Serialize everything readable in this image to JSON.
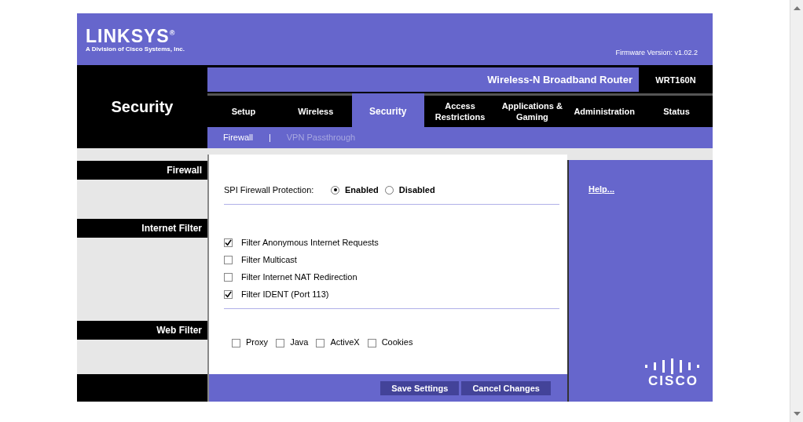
{
  "header": {
    "logo": "LINKSYS$^{®}$",
    "tagline": "A Division of Cisco Systems, Inc.",
    "firmware": "Firmware Version: v1.02.2"
  },
  "page_title": "Security",
  "product": {
    "name": "Wireless-N Broadband Router",
    "model": "WRT160N"
  },
  "tabs": [
    {
      "label": "Setup",
      "selected": false
    },
    {
      "label": "Wireless",
      "selected": false
    },
    {
      "label": "Security",
      "selected": true
    },
    {
      "label": "Access Restrictions",
      "selected": false
    },
    {
      "label": "Applications & Gaming",
      "selected": false
    },
    {
      "label": "Administration",
      "selected": false
    },
    {
      "label": "Status",
      "selected": false
    }
  ],
  "subtabs": [
    {
      "label": "Firewall",
      "selected": true
    },
    {
      "label": "VPN Passthrough",
      "selected": false
    }
  ],
  "subtab_separator": "|",
  "sections": [
    "Firewall",
    "Internet Filter",
    "Web Filter"
  ],
  "spi": {
    "label": "SPI Firewall Protection:",
    "options": [
      {
        "label": "Enabled",
        "selected": true
      },
      {
        "label": "Disabled",
        "selected": false
      }
    ]
  },
  "internet_filters": [
    {
      "label": "Filter Anonymous Internet Requests",
      "checked": true
    },
    {
      "label": "Filter Multicast",
      "checked": false
    },
    {
      "label": "Filter Internet NAT Redirection",
      "checked": false
    },
    {
      "label": "Filter IDENT (Port 113)",
      "checked": true
    }
  ],
  "web_filters": [
    {
      "label": "Proxy",
      "checked": false
    },
    {
      "label": "Java",
      "checked": false
    },
    {
      "label": "ActiveX",
      "checked": false
    },
    {
      "label": "Cookies",
      "checked": false
    }
  ],
  "help_link": "Help...",
  "cisco_logo": "CISCO",
  "buttons": [
    "Save Settings",
    "Cancel Changes"
  ]
}
